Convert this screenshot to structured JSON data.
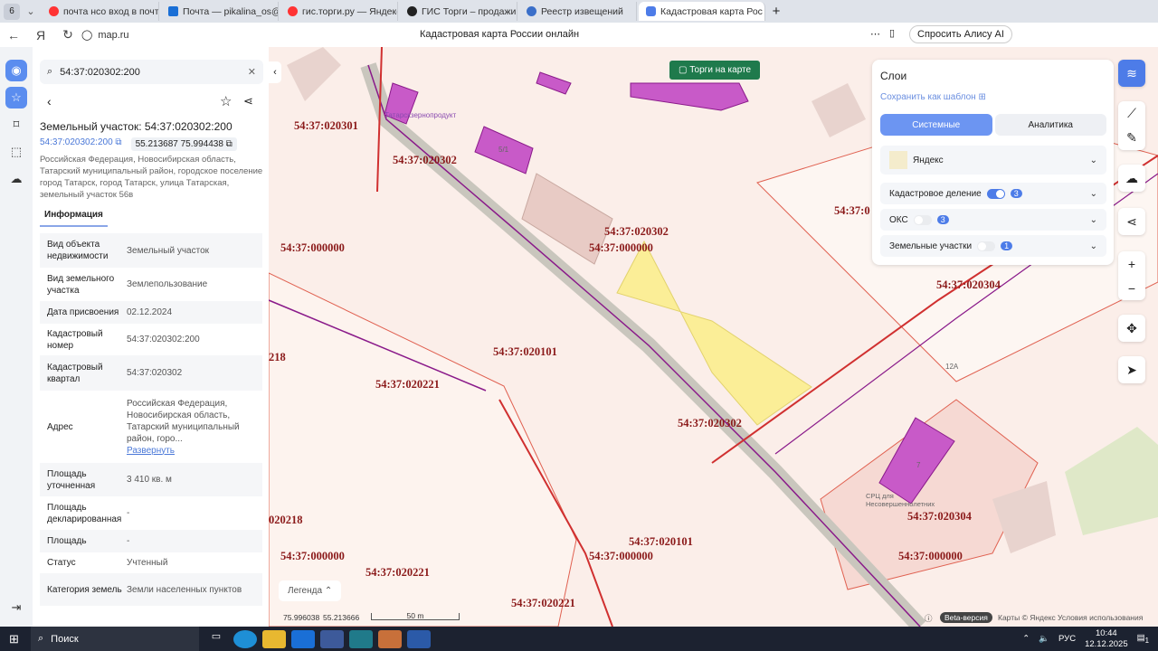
{
  "browser": {
    "tab_count": "6",
    "tabs": [
      "почта нсо вход в почту —",
      "Почта — pikalina_os@nso",
      "гис.торги.ру — Яндекс: н",
      "ГИС Торги – продажи гос",
      "Реестр извещений",
      "Кадастровая карта Рос"
    ],
    "url": "map.ru",
    "page_title": "Кадастровая карта России онлайн",
    "alice": "Спросить Алису AI"
  },
  "panel": {
    "search_value": "54:37:020302:200",
    "title": "Земельный участок: 54:37:020302:200",
    "cad_link": "54:37:020302:200",
    "coords": "55.213687 75.994438",
    "address": "Российская Федерация, Новосибирская область, Татарский муниципальный район, городское поселение город Татарск, город Татарск, улица Татарская, земельный участок 56в",
    "tab": "Информация",
    "rows": [
      {
        "k": "Вид объекта недвижимости",
        "v": "Земельный участок"
      },
      {
        "k": "Вид земельного участка",
        "v": "Землепользование"
      },
      {
        "k": "Дата присвоения",
        "v": "02.12.2024"
      },
      {
        "k": "Кадастровый номер",
        "v": "54:37:020302:200"
      },
      {
        "k": "Кадастровый квартал",
        "v": "54:37:020302"
      },
      {
        "k": "Адрес",
        "v": "Российская Федерация, Новосибирская область, Татарский муниципальный район, горо...",
        "link": "Развернуть"
      },
      {
        "k": "Площадь уточненная",
        "v": "3 410 кв. м"
      },
      {
        "k": "Площадь декларированная",
        "v": "-"
      },
      {
        "k": "Площадь",
        "v": "-"
      },
      {
        "k": "Статус",
        "v": "Учтенный"
      },
      {
        "k": "Категория земель",
        "v": "Земли населенных пунктов"
      }
    ]
  },
  "map": {
    "torgi": "Торги на карте",
    "labels": [
      "54:37:020301",
      "54:37:020302",
      "54:37:020302",
      "54:37:000000",
      "54:37:000000",
      "54:37:020101",
      "54:37:020221",
      "54:37:020302",
      "54:37:020304",
      "54:37:020304",
      "54:37:000000",
      "54:37:020101",
      "54:37:000000",
      "54:37:020221",
      "54:37:000000",
      "54:37:020221",
      "218",
      "020218",
      "54:37:0"
    ],
    "poi": [
      "Татарскзернопродукт",
      "СРЦ для Несовершеннолетних",
      "12А",
      "5/1",
      "7"
    ],
    "legend": "Легенда",
    "lon": "75.996038",
    "lat": "55.213666",
    "scale": "50 m",
    "beta": "Beta-версия",
    "copyright": "Карты © Яндекс",
    "terms": "Условия использования"
  },
  "layers": {
    "title": "Слои",
    "save": "Сохранить как шаблон",
    "tab_system": "Системные",
    "tab_analytics": "Аналитика",
    "base": "Яндекс",
    "items": [
      {
        "name": "Кадастровое деление",
        "on": true,
        "count": "3"
      },
      {
        "name": "ОКС",
        "on": false,
        "count": "3"
      },
      {
        "name": "Земельные участки",
        "on": false,
        "count": "1"
      }
    ]
  },
  "taskbar": {
    "search": "Поиск",
    "lang": "РУС",
    "time": "10:44",
    "date": "12.12.2025",
    "notif": "1"
  }
}
